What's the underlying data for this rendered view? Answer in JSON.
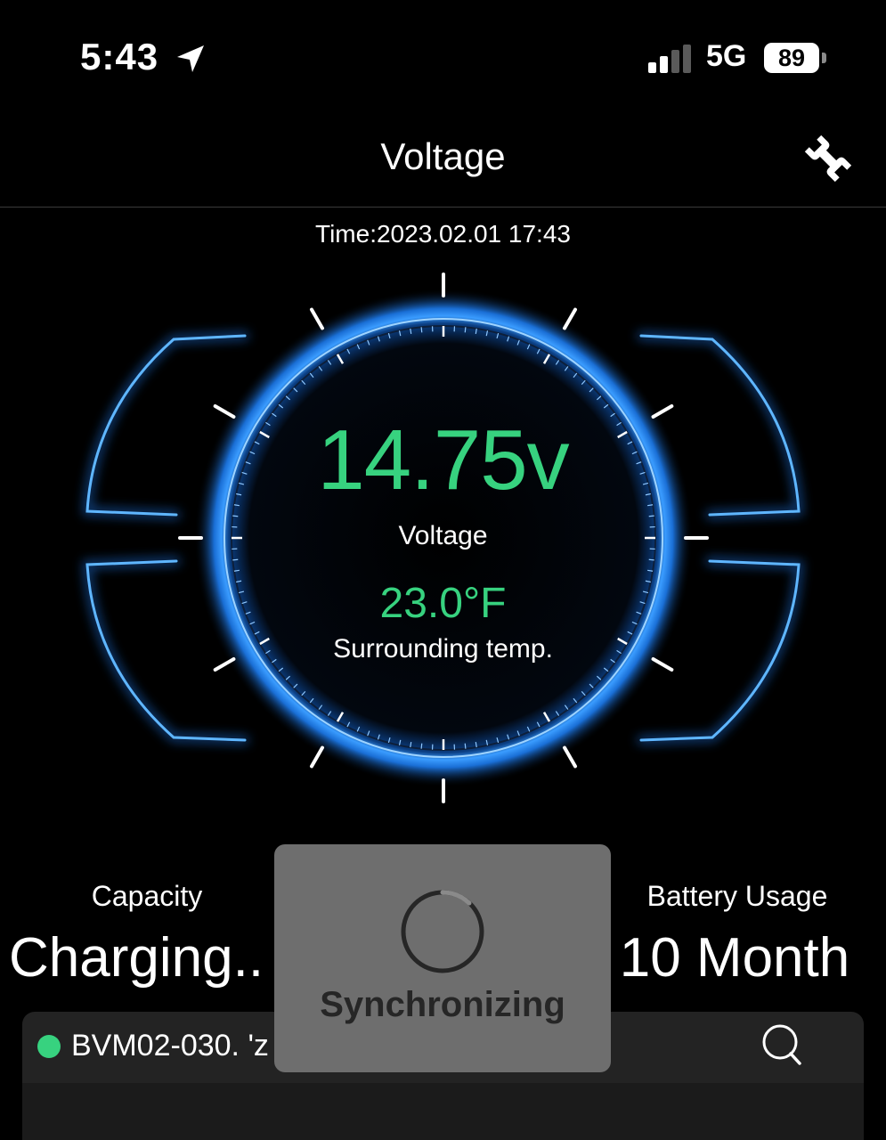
{
  "status_bar": {
    "time": "5:43",
    "network": "5G",
    "battery_level": "89",
    "signal_bars_active": 2,
    "signal_bars_total": 4
  },
  "nav": {
    "title": "Voltage",
    "settings_icon": "wrench-icon"
  },
  "reading": {
    "time_label": "Time:2023.02.01 17:43",
    "voltage": "14.75v",
    "voltage_label": "Voltage",
    "temperature": "23.0°F",
    "temperature_label": "Surrounding temp."
  },
  "stats": {
    "capacity_label": "Capacity",
    "capacity_value": "Charging..",
    "usage_label": "Battery Usage",
    "usage_value": "10 Month"
  },
  "device": {
    "name": "BVM02-030. 'z",
    "status_color": "#37d27f",
    "search_icon": "search-icon"
  },
  "overlay": {
    "label": "Synchronizing"
  },
  "colors": {
    "accent_green": "#37d27f",
    "gauge_blue": "#3a9cff",
    "background": "#000000"
  }
}
